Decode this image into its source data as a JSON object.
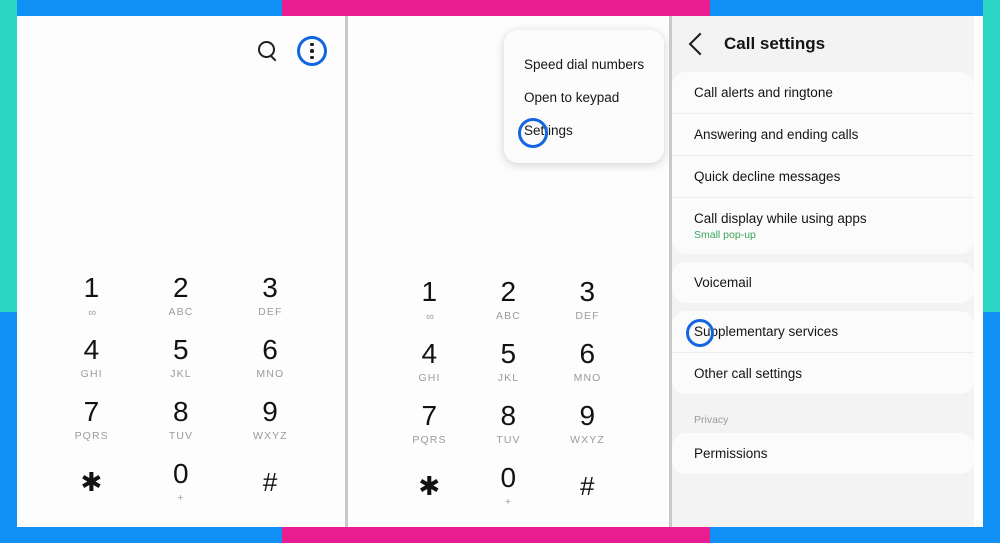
{
  "theme": {
    "blue": "#1190f5",
    "pink": "#e81e90",
    "teal": "#2bd6c4",
    "focus_ring": "#1266e0",
    "subtitle_green": "#3ba45c"
  },
  "dialer": {
    "search_icon": "search-icon",
    "more_icon": "three-dot-menu-icon",
    "keys": [
      {
        "digit": "1",
        "sub": "∞",
        "is_voicemail": true
      },
      {
        "digit": "2",
        "sub": "ABC"
      },
      {
        "digit": "3",
        "sub": "DEF"
      },
      {
        "digit": "4",
        "sub": "GHI"
      },
      {
        "digit": "5",
        "sub": "JKL"
      },
      {
        "digit": "6",
        "sub": "MNO"
      },
      {
        "digit": "7",
        "sub": "PQRS"
      },
      {
        "digit": "8",
        "sub": "TUV"
      },
      {
        "digit": "9",
        "sub": "WXYZ"
      },
      {
        "digit": "✱",
        "sub": ""
      },
      {
        "digit": "0",
        "sub": "+"
      },
      {
        "digit": "#",
        "sub": ""
      }
    ]
  },
  "overflow_menu": {
    "items": [
      {
        "label": "Speed dial numbers",
        "highlighted": false
      },
      {
        "label": "Open to keypad",
        "highlighted": false
      },
      {
        "label": "Settings",
        "highlighted": true
      }
    ]
  },
  "call_settings": {
    "back_icon": "back-chevron-icon",
    "title": "Call settings",
    "groups": [
      {
        "label": "",
        "rows": [
          {
            "title": "Call alerts and ringtone",
            "sub": "",
            "highlighted": false
          },
          {
            "title": "Answering and ending calls",
            "sub": "",
            "highlighted": false
          },
          {
            "title": "Quick decline messages",
            "sub": "",
            "highlighted": false
          },
          {
            "title": "Call display while using apps",
            "sub": "Small pop-up",
            "highlighted": false
          }
        ]
      },
      {
        "label": "",
        "rows": [
          {
            "title": "Voicemail",
            "sub": "",
            "highlighted": false
          }
        ]
      },
      {
        "label": "",
        "rows": [
          {
            "title": "Supplementary services",
            "sub": "",
            "highlighted": true
          },
          {
            "title": "Other call settings",
            "sub": "",
            "highlighted": false
          }
        ]
      },
      {
        "label": "Privacy",
        "rows": [
          {
            "title": "Permissions",
            "sub": "",
            "highlighted": false
          }
        ]
      }
    ]
  }
}
